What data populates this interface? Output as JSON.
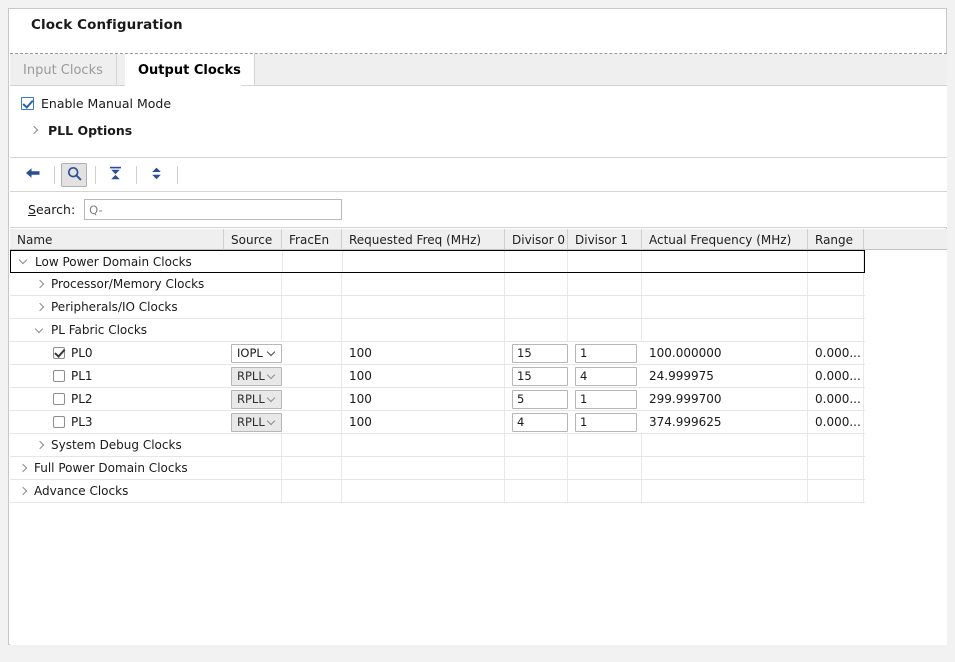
{
  "window": {
    "title": "Clock Configuration"
  },
  "tabs": [
    {
      "label": "Input Clocks",
      "active": false
    },
    {
      "label": "Output Clocks",
      "active": true
    }
  ],
  "options": {
    "manual_mode_label": "Enable Manual Mode",
    "manual_mode_checked": true,
    "pll_options_label": "PLL Options",
    "pll_options_expanded": false
  },
  "toolbar": {
    "buttons": [
      {
        "icon": "back-arrow-icon",
        "pressed": false
      },
      {
        "icon": "search-icon",
        "pressed": true
      },
      {
        "icon": "collapse-all-icon",
        "pressed": false
      },
      {
        "icon": "expand-all-icon",
        "pressed": false
      }
    ]
  },
  "search": {
    "label_prefix": "S",
    "label_rest": "earch:",
    "value": "",
    "placeholder": "Q-"
  },
  "table": {
    "columns": [
      "Name",
      "Source",
      "FracEn",
      "Requested Freq (MHz)",
      "Divisor 0",
      "Divisor 1",
      "Actual Frequency (MHz)",
      "Range"
    ],
    "rows": [
      {
        "type": "group",
        "level": 0,
        "expanded": true,
        "selected": true,
        "name": "Low Power Domain Clocks"
      },
      {
        "type": "group",
        "level": 1,
        "expanded": false,
        "selected": false,
        "name": "Processor/Memory Clocks"
      },
      {
        "type": "group",
        "level": 1,
        "expanded": false,
        "selected": false,
        "name": "Peripherals/IO Clocks"
      },
      {
        "type": "group",
        "level": 1,
        "expanded": true,
        "selected": false,
        "name": "PL Fabric Clocks"
      },
      {
        "type": "clock",
        "level": 2,
        "name": "PL0",
        "enabled": true,
        "source": "IOPL",
        "source_disabled": false,
        "fracen": "",
        "requested": "100",
        "divisor0": "15",
        "divisor1": "1",
        "actual": "100.000000",
        "range": "0.000..."
      },
      {
        "type": "clock",
        "level": 2,
        "name": "PL1",
        "enabled": false,
        "source": "RPLL",
        "source_disabled": true,
        "fracen": "",
        "requested": "100",
        "divisor0": "15",
        "divisor1": "4",
        "actual": "24.999975",
        "range": "0.000..."
      },
      {
        "type": "clock",
        "level": 2,
        "name": "PL2",
        "enabled": false,
        "source": "RPLL",
        "source_disabled": true,
        "fracen": "",
        "requested": "100",
        "divisor0": "5",
        "divisor1": "1",
        "actual": "299.999700",
        "range": "0.000..."
      },
      {
        "type": "clock",
        "level": 2,
        "name": "PL3",
        "enabled": false,
        "source": "RPLL",
        "source_disabled": true,
        "fracen": "",
        "requested": "100",
        "divisor0": "4",
        "divisor1": "1",
        "actual": "374.999625",
        "range": "0.000..."
      },
      {
        "type": "group",
        "level": 1,
        "expanded": false,
        "selected": false,
        "name": "System Debug Clocks"
      },
      {
        "type": "group",
        "level": 0,
        "expanded": false,
        "selected": false,
        "name": "Full Power Domain Clocks"
      },
      {
        "type": "group",
        "level": 0,
        "expanded": false,
        "selected": false,
        "name": "Advance Clocks"
      }
    ]
  },
  "colors": {
    "accent": "#2a5fa8",
    "icon": "#2a4f91",
    "header_bg": "#efefef",
    "panel_bg": "#ffffff",
    "outer_bg": "#f2f2f2"
  }
}
